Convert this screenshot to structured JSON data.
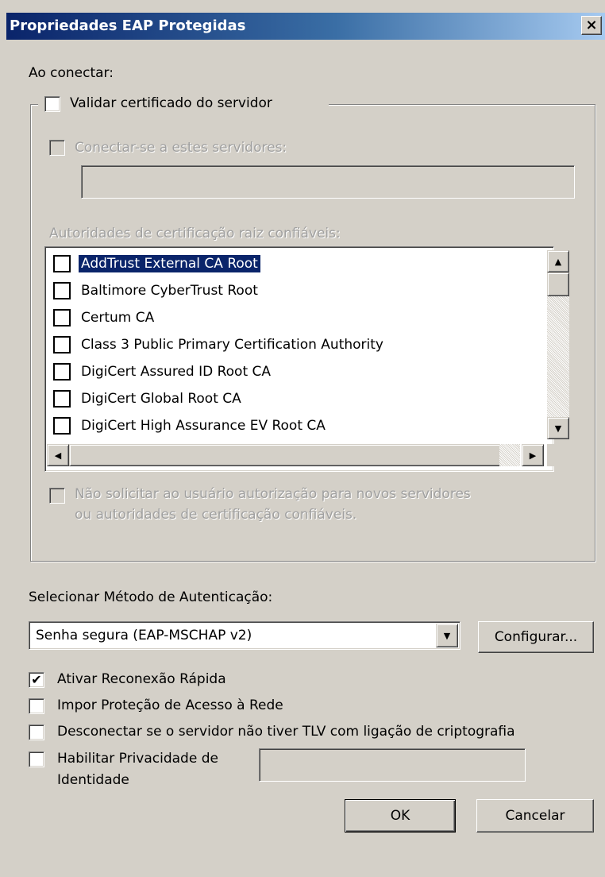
{
  "window": {
    "title": "Propriedades EAP Protegidas",
    "close_glyph": "×"
  },
  "on_connect_label": "Ao conectar:",
  "validate_cert": {
    "label": "Validar certificado do servidor",
    "checked": false
  },
  "connect_servers": {
    "label": "Conectar-se a estes servidores:",
    "value": "",
    "enabled": false
  },
  "trusted_roots_label": "Autoridades de certificação raiz confiáveis:",
  "cert_list": [
    {
      "label": "AddTrust External CA Root",
      "selected": true
    },
    {
      "label": "Baltimore CyberTrust Root",
      "selected": false
    },
    {
      "label": "Certum CA",
      "selected": false
    },
    {
      "label": "Class 3 Public Primary Certification Authority",
      "selected": false
    },
    {
      "label": "DigiCert Assured ID Root CA",
      "selected": false
    },
    {
      "label": "DigiCert Global Root CA",
      "selected": false
    },
    {
      "label": "DigiCert High Assurance EV Root CA",
      "selected": false
    }
  ],
  "scroll_glyphs": {
    "up": "▲",
    "down": "▼",
    "left": "◀",
    "right": "▶"
  },
  "no_prompt": {
    "line1": "Não solicitar ao usuário autorização para novos servidores",
    "line2": "ou autoridades de certificação confiáveis.",
    "enabled": false
  },
  "auth_method_label": "Selecionar Método de Autenticação:",
  "auth_method": {
    "selected": "Senha segura (EAP-MSCHAP v2)",
    "dropdown_glyph": "▼"
  },
  "configure_button": "Configurar...",
  "options": {
    "fast_reconnect": {
      "label": "Ativar Reconexão Rápida",
      "checked": true
    },
    "nap": {
      "label": "Impor Proteção de Acesso à Rede",
      "checked": false
    },
    "tlv": {
      "label": "Desconectar se o servidor não tiver TLV com ligação de criptografia",
      "checked": false
    },
    "identity_privacy": {
      "line1": "Habilitar Privacidade de",
      "line2": "Identidade",
      "checked": false,
      "value": ""
    }
  },
  "check_glyph": "✔",
  "ok_button": "OK",
  "cancel_button": "Cancelar"
}
